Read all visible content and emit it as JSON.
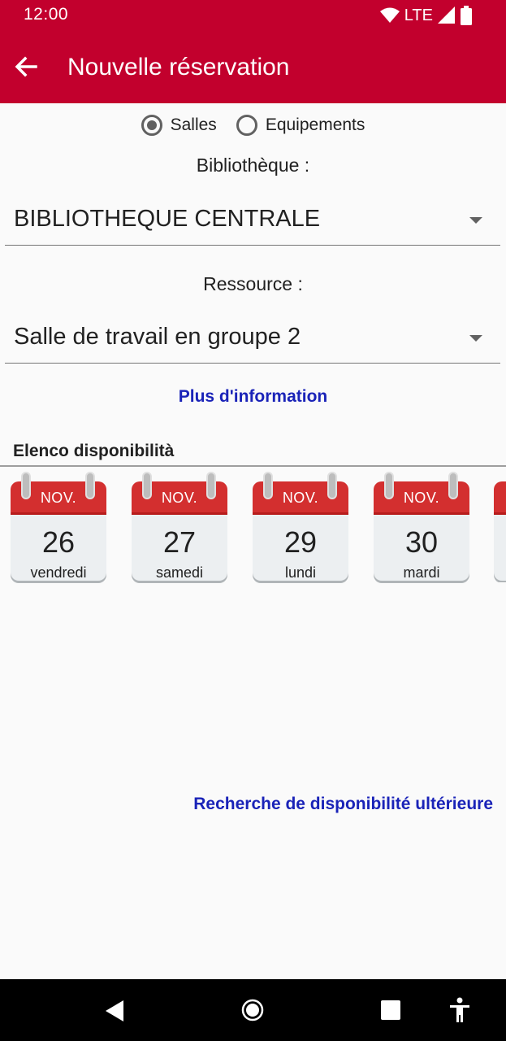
{
  "status_bar": {
    "time": "12:00",
    "network": "LTE",
    "icons": [
      "wifi-icon",
      "signal-icon",
      "battery-icon"
    ]
  },
  "app_bar": {
    "title": "Nouvelle réservation",
    "back_icon": "arrow-back-icon"
  },
  "type_selector": {
    "options": [
      {
        "label": "Salles",
        "checked": true
      },
      {
        "label": "Equipements",
        "checked": false
      }
    ]
  },
  "library": {
    "label": "Bibliothèque :",
    "value": "BIBLIOTHEQUE CENTRALE"
  },
  "resource": {
    "label": "Ressource :",
    "value": "Salle de travail en groupe 2"
  },
  "more_info_link": "Plus d'information",
  "availability": {
    "title": "Elenco disponibilità",
    "days": [
      {
        "month": "NOV.",
        "day": "26",
        "weekday": "vendredi"
      },
      {
        "month": "NOV.",
        "day": "27",
        "weekday": "samedi"
      },
      {
        "month": "NOV.",
        "day": "29",
        "weekday": "lundi"
      },
      {
        "month": "NOV.",
        "day": "30",
        "weekday": "mardi"
      }
    ]
  },
  "later_search_link": "Recherche de disponibilité ultérieure",
  "colors": {
    "primary": "#c2002d",
    "link": "#1a23b8",
    "calendar_red": "#d32f2f"
  }
}
